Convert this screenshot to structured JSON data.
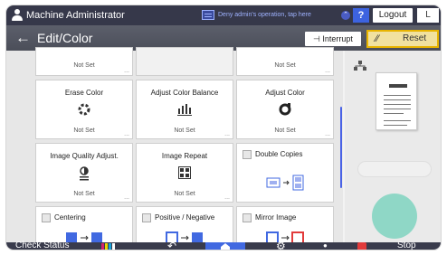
{
  "header": {
    "user_name": "Machine Administrator",
    "message": "Deny admin's operation, tap here",
    "help_label": "?",
    "logout_label": "Logout",
    "language_label": "L"
  },
  "titlebar": {
    "back_icon": "back-arrow-icon",
    "title": "Edit/Color",
    "interrupt_label": "Interrupt",
    "reset_label": "Reset"
  },
  "tiles": {
    "top_row": [
      "Not Set",
      "",
      "Not Set"
    ],
    "erase_color": {
      "label": "Erase Color",
      "value": "Not Set",
      "icon": "erase-color-icon"
    },
    "adjust_color_balance": {
      "label": "Adjust Color Balance",
      "value": "Not Set",
      "icon": "color-balance-icon"
    },
    "adjust_color": {
      "label": "Adjust Color",
      "value": "Not Set",
      "icon": "adjust-color-icon"
    },
    "image_quality": {
      "label": "Image Quality Adjust.",
      "value": "Not Set",
      "icon": "image-quality-icon"
    },
    "image_repeat": {
      "label": "Image Repeat",
      "value": "Not Set",
      "icon": "image-repeat-icon"
    },
    "double_copies": {
      "label": "Double Copies",
      "icon": "double-copies-icon"
    },
    "centering": {
      "label": "Centering",
      "icon": "centering-icon"
    },
    "positive_negative": {
      "label": "Positive / Negative",
      "icon": "positive-negative-icon"
    },
    "mirror_image": {
      "label": "Mirror Image",
      "icon": "mirror-image-icon"
    }
  },
  "preview": {
    "icon": "preview-layout-icon",
    "check_settings_label": "",
    "start_label": ""
  },
  "bottom": {
    "check_status_label": "Check Status",
    "stop_label": "Stop"
  },
  "colors": {
    "accent_blue": "#4169e1",
    "reset_yellow": "#e8b400",
    "start_teal": "#8fd7c6",
    "topbar": "#36384a"
  }
}
